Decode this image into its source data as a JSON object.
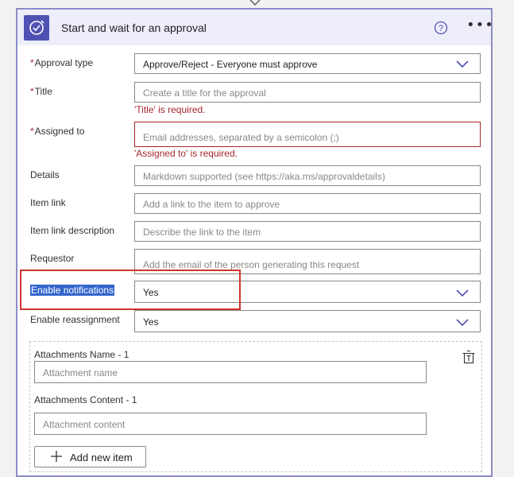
{
  "header": {
    "title": "Start and wait for an approval"
  },
  "form": {
    "approval_type": {
      "label": "Approval type",
      "value": "Approve/Reject - Everyone must approve"
    },
    "title": {
      "label": "Title",
      "placeholder": "Create a title for the approval",
      "error": "'Title' is required."
    },
    "assigned_to": {
      "label": "Assigned to",
      "placeholder": "Email addresses, separated by a semicolon (;)",
      "error": "'Assigned to' is required."
    },
    "details": {
      "label": "Details",
      "placeholder": "Markdown supported (see https://aka.ms/approvaldetails)"
    },
    "item_link": {
      "label": "Item link",
      "placeholder": "Add a link to the item to approve"
    },
    "item_link_description": {
      "label": "Item link description",
      "placeholder": "Describe the link to the item"
    },
    "requestor": {
      "label": "Requestor",
      "placeholder": "Add the email of the person generating this request"
    },
    "enable_notifications": {
      "label": "Enable notifications",
      "value": "Yes"
    },
    "enable_reassignment": {
      "label": "Enable reassignment",
      "value": "Yes"
    },
    "required_marker": "*"
  },
  "attachments": {
    "name_label": "Attachments Name - 1",
    "name_placeholder": "Attachment name",
    "content_label": "Attachments Content - 1",
    "content_placeholder": "Attachment content",
    "add_button": "Add new item"
  },
  "colors": {
    "accent": "#4f52b2",
    "error": "#a4262c",
    "highlight_box": "#d1332e",
    "header_bg": "#eeeefb"
  },
  "icons": [
    "approval-icon",
    "help-icon",
    "more-icon",
    "chevron-down-icon",
    "delete-icon",
    "plus-icon"
  ]
}
